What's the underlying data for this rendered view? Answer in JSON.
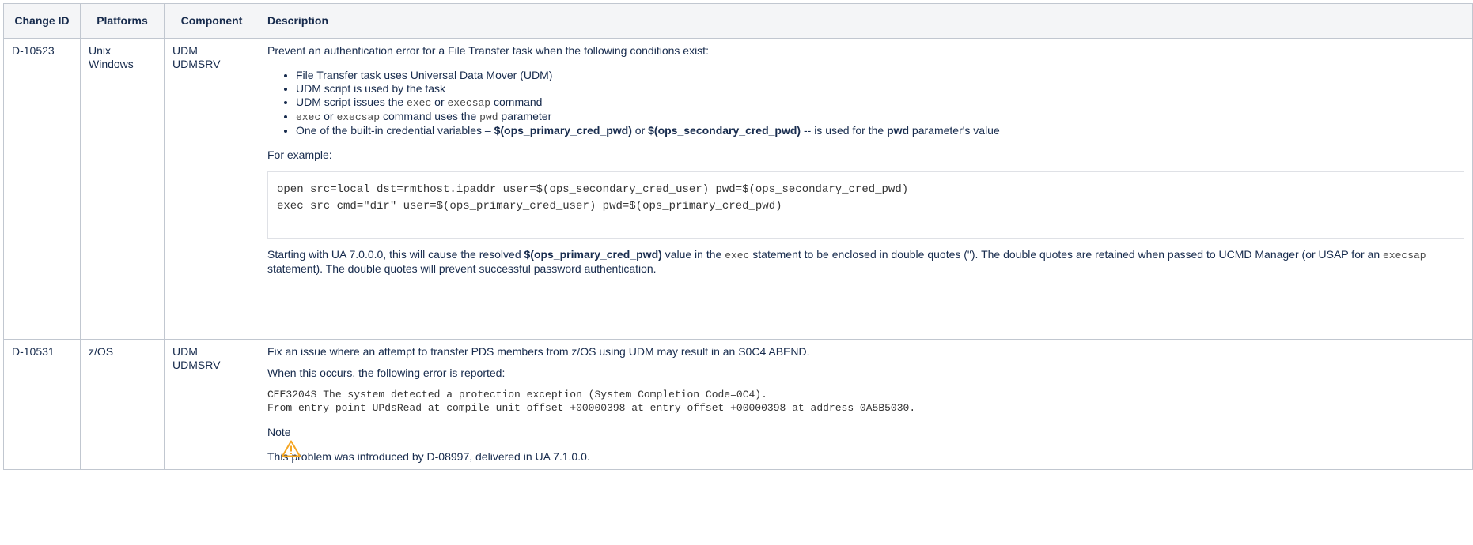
{
  "headers": {
    "change_id": "Change ID",
    "platforms": "Platforms",
    "component": "Component",
    "description": "Description"
  },
  "rows": [
    {
      "change_id": "D-10523",
      "platforms": [
        "Unix",
        "Windows"
      ],
      "component": [
        "UDM",
        "UDMSRV"
      ],
      "intro": "Prevent an authentication error for a File Transfer task when the following conditions exist:",
      "conditions": {
        "c1": "File Transfer task uses Universal Data Mover (UDM)",
        "c2": "UDM script is used by the task",
        "c3_pre": "UDM script issues the ",
        "c3_code1": "exec",
        "c3_mid": " or ",
        "c3_code2": "execsap",
        "c3_post": " command",
        "c4_code1": "exec",
        "c4_mid": " or ",
        "c4_code2": "execsap",
        "c4_mid2": " command uses the ",
        "c4_code3": "pwd",
        "c4_post": " parameter",
        "c5_pre": "One of the built-in credential variables – ",
        "c5_b1": "$(ops_primary_cred_pwd)",
        "c5_mid": " or ",
        "c5_b2": "$(ops_secondary_cred_pwd)",
        "c5_mid2": " -- is used for the ",
        "c5_b3": "pwd",
        "c5_post": " parameter's value"
      },
      "example_label": "For example:",
      "code_lines": [
        "open src=local dst=rmthost.ipaddr user=$(ops_secondary_cred_user) pwd=$(ops_secondary_cred_pwd)",
        "exec src cmd=\"dir\" user=$(ops_primary_cred_user) pwd=$(ops_primary_cred_pwd)"
      ],
      "outro": {
        "p1": "Starting with UA 7.0.0.0, this will cause the resolved ",
        "b1": "$(ops_primary_cred_pwd)",
        "p2": " value in the ",
        "code1": "exec",
        "p3": " statement to be enclosed in double quotes (\"). The double quotes are retained when passed to UCMD Manager (or USAP for an ",
        "code2": "execsap",
        "p4": " statement). The double quotes will prevent successful password authentication."
      }
    },
    {
      "change_id": "D-10531",
      "platforms": [
        "z/OS"
      ],
      "component": [
        "UDM",
        "UDMSRV"
      ],
      "intro": "Fix an issue where an attempt to transfer PDS members from z/OS using UDM may result in an S0C4 ABEND.",
      "error_intro": "When this occurs, the following error is reported:",
      "error_lines": [
        "CEE3204S The system detected a protection exception (System Completion Code=0C4).",
        "From entry point UPdsRead at compile unit offset +00000398 at entry offset +00000398 at address 0A5B5030."
      ],
      "note_title": "Note",
      "note_icon": "warning-icon",
      "note_text": "This problem was introduced by D-08997, delivered in UA 7.1.0.0.",
      "warning_color": "#f5a623"
    }
  ]
}
